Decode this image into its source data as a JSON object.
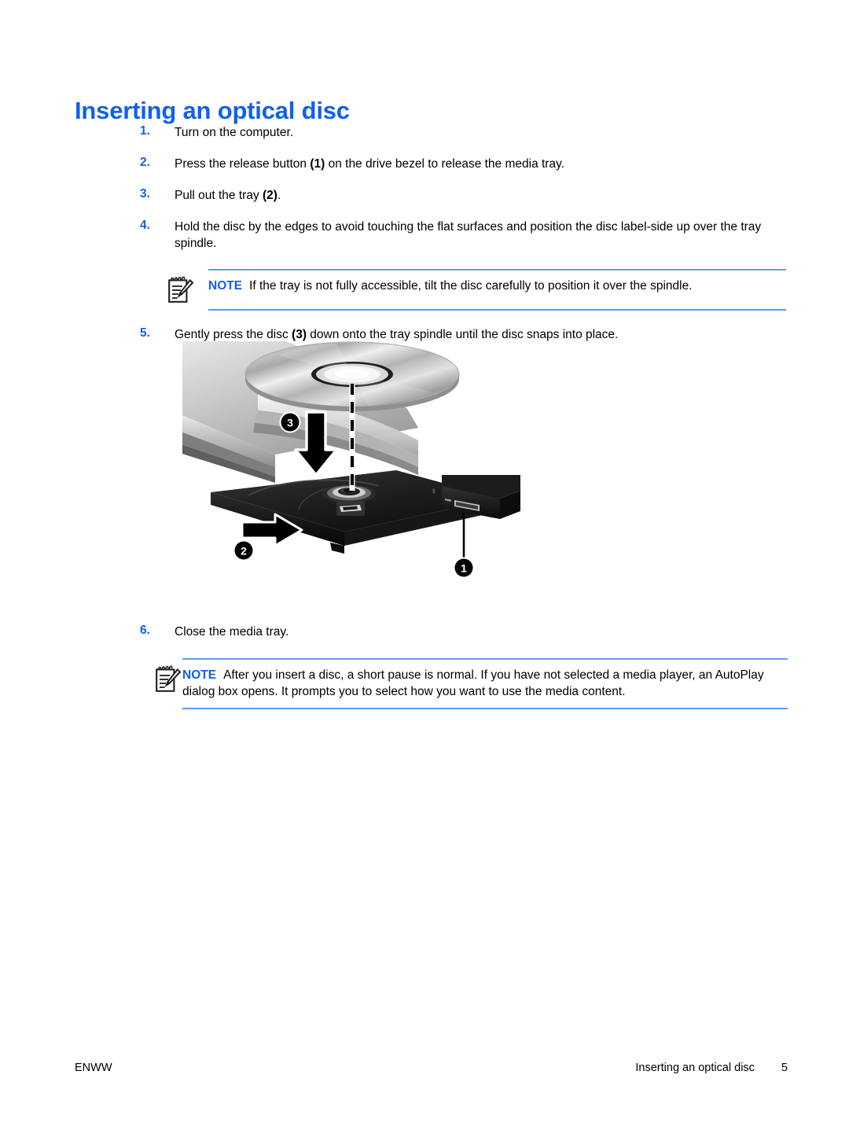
{
  "document": {
    "title": "Inserting an optical disc",
    "heading_color": "#1160ec",
    "rule_color": "#5d9cf5"
  },
  "steps": [
    {
      "number": "1.",
      "text_before": "Turn on the computer.",
      "bold": "",
      "text_after": ""
    },
    {
      "number": "2.",
      "text_before": "Press the release button ",
      "bold": "(1)",
      "text_after": " on the drive bezel to release the media tray."
    },
    {
      "number": "3.",
      "text_before": "Pull out the tray ",
      "bold": "(2)",
      "text_after": "."
    },
    {
      "number": "4.",
      "text_before": "Hold the disc by the edges to avoid touching the flat surfaces and position the disc label-side up over the tray spindle.",
      "bold": "",
      "text_after": ""
    },
    {
      "number": "5.",
      "text_before": "Gently press the disc ",
      "bold": "(3)",
      "text_after": " down onto the tray spindle until the disc snaps into place."
    },
    {
      "number": "6.",
      "text_before": "Close the media tray.",
      "bold": "",
      "text_after": ""
    }
  ],
  "notes": {
    "label": "NOTE",
    "icon_name": "note-pad-pencil-icon",
    "first": {
      "label": "NOTE",
      "text": "If the tray is not fully accessible, tilt the disc carefully to position it over the spindle."
    },
    "second": {
      "label": "NOTE",
      "text": "After you insert a disc, a short pause is normal. If you have not selected a media player, an AutoPlay dialog box opens. It prompts you to select how you want to use the media content."
    }
  },
  "figure": {
    "name": "optical-drive-disc-insertion-illustration",
    "alt": "Laptop corner with open optical drive tray, disc above spindle",
    "callouts": [
      {
        "id": "1",
        "label": "1",
        "meaning": "release button on drive bezel"
      },
      {
        "id": "2",
        "label": "2",
        "meaning": "pull out the tray"
      },
      {
        "id": "3",
        "label": "3",
        "meaning": "press the disc down onto the spindle"
      }
    ]
  },
  "footer": {
    "left": "ENWW",
    "chapter": "Inserting an optical disc",
    "page": "5"
  }
}
